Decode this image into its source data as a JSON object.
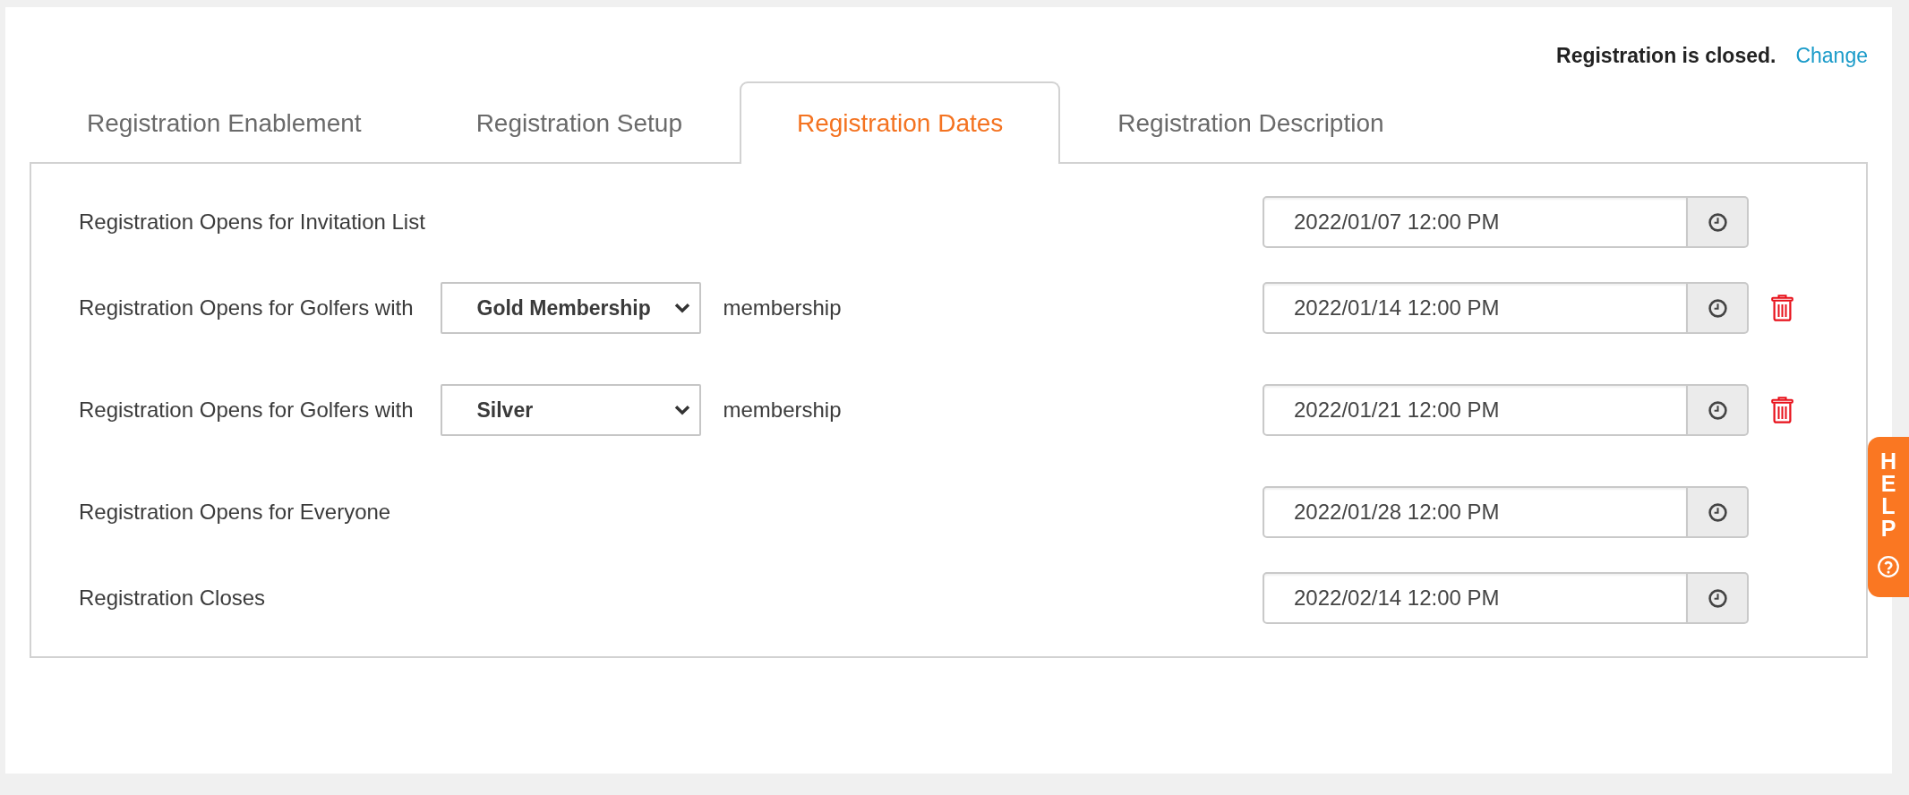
{
  "status": {
    "text": "Registration is closed.",
    "link": "Change"
  },
  "tabs": [
    {
      "label": "Registration Enablement",
      "selected": false
    },
    {
      "label": "Registration Setup",
      "selected": false
    },
    {
      "label": "Registration Dates",
      "selected": true
    },
    {
      "label": "Registration Description",
      "selected": false
    }
  ],
  "rows": [
    {
      "kind": "plain",
      "label": "Registration Opens for Invitation List",
      "date": "2022/01/07 12:00 PM",
      "removable": false
    },
    {
      "kind": "membership",
      "label": "Registration Opens for Golfers with",
      "membership": "Gold Membership",
      "suffix": "membership",
      "date": "2022/01/14 12:00 PM",
      "removable": true
    },
    {
      "kind": "membership",
      "label": "Registration Opens for Golfers with",
      "membership": "Silver",
      "suffix": "membership",
      "date": "2022/01/21 12:00 PM",
      "removable": true
    },
    {
      "kind": "plain",
      "label": "Registration Opens for Everyone",
      "date": "2022/01/28 12:00 PM",
      "removable": false
    },
    {
      "kind": "plain",
      "label": "Registration Closes",
      "date": "2022/02/14 12:00 PM",
      "removable": false
    }
  ],
  "help_tab": {
    "label": "HELP"
  }
}
